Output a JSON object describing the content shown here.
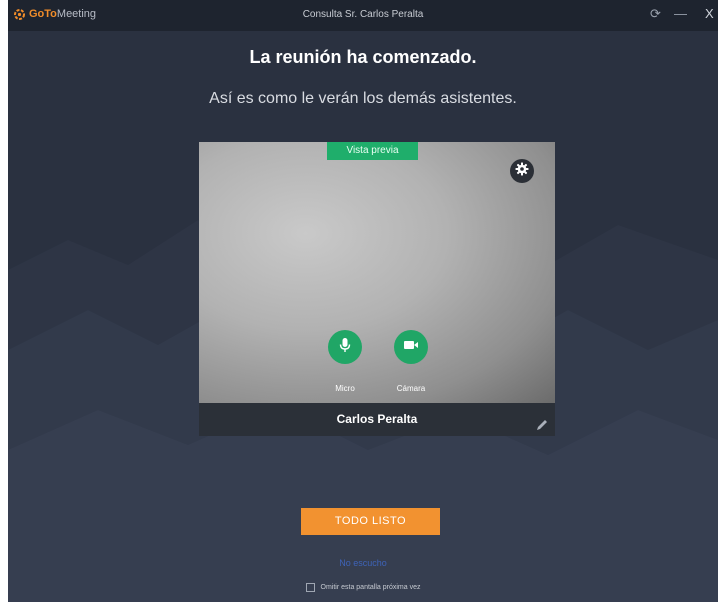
{
  "titlebar": {
    "app_name_prefix": "GoTo",
    "app_name_suffix": "Meeting",
    "window_title": "Consulta Sr. Carlos Peralta",
    "restore_glyph": "⟳",
    "minimize_glyph": "—",
    "close_glyph": "X"
  },
  "main": {
    "heading": "La reunión ha comenzado.",
    "subheading": "Así es como le verán los demás asistentes."
  },
  "preview": {
    "tag": "Vista previa",
    "settings_icon": "gear-icon",
    "mic_label": "Micro",
    "camera_label": "Cámara",
    "name": "Carlos Peralta"
  },
  "actions": {
    "ready_button": "TODO LISTO",
    "link": "No escucho",
    "skip_checkbox_label": "Omitir esta pantalla próxima vez"
  },
  "colors": {
    "background": "#2a3140",
    "titlebar": "#1e242f",
    "accent_green": "#20a666",
    "accent_orange": "#f29230"
  }
}
